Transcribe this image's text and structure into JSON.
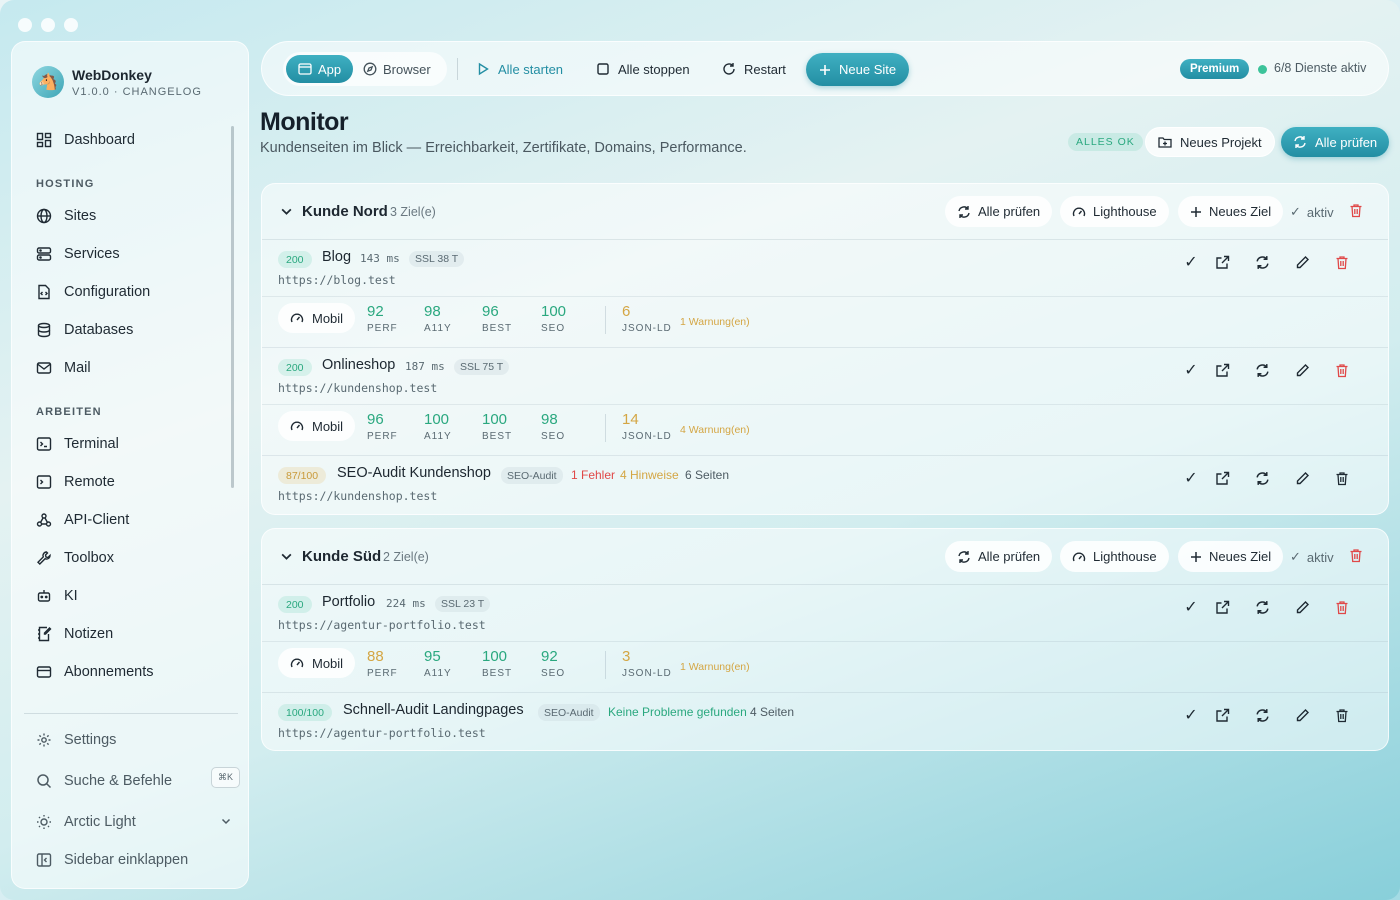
{
  "brand": {
    "name": "WebDonkey",
    "version": "V1.0.0 · CHANGELOG"
  },
  "sidebar": {
    "dashboard": "Dashboard",
    "hosting_label": "HOSTING",
    "hosting": [
      "Sites",
      "Services",
      "Configuration",
      "Databases",
      "Mail"
    ],
    "arbeiten_label": "ARBEITEN",
    "arbeiten": [
      "Terminal",
      "Remote",
      "API-Client",
      "Toolbox",
      "KI",
      "Notizen",
      "Abonnements"
    ],
    "settings": "Settings",
    "search": "Suche & Befehle",
    "search_shortcut": "⌘K",
    "theme": "Arctic Light",
    "collapse": "Sidebar einklappen"
  },
  "topbar": {
    "app": "App",
    "browser": "Browser",
    "start_all": "Alle starten",
    "stop_all": "Alle stoppen",
    "restart": "Restart",
    "new_site": "Neue Site",
    "premium": "Premium",
    "status": "6/8 Dienste aktiv"
  },
  "header": {
    "title": "Monitor",
    "subtitle": "Kundenseiten im Blick — Erreichbarkeit, Zertifikate, Domains, Performance.",
    "ok_badge": "ALLES OK",
    "new_project": "Neues Projekt",
    "check_all": "Alle prüfen"
  },
  "group_buttons": {
    "check_all": "Alle prüfen",
    "lighthouse": "Lighthouse",
    "new_target": "Neues Ziel",
    "active": "aktiv"
  },
  "groups": [
    {
      "name": "Kunde Nord",
      "count": "3 Ziel(e)",
      "rows": [
        {
          "code": "200",
          "name": "Blog",
          "ms": "143 ms",
          "ssl": "SSL 38 T",
          "url": "https://blog.test",
          "device": "Mobil",
          "scores": [
            {
              "v": "92",
              "l": "PERF"
            },
            {
              "v": "98",
              "l": "A11Y"
            },
            {
              "v": "96",
              "l": "BEST"
            },
            {
              "v": "100",
              "l": "SEO"
            }
          ],
          "jsonld": {
            "v": "6",
            "l": "JSON-LD"
          },
          "warnings": "1 Warnung(en)"
        },
        {
          "code": "200",
          "name": "Onlineshop",
          "ms": "187 ms",
          "ssl": "SSL 75 T",
          "url": "https://kundenshop.test",
          "device": "Mobil",
          "scores": [
            {
              "v": "96",
              "l": "PERF"
            },
            {
              "v": "100",
              "l": "A11Y"
            },
            {
              "v": "100",
              "l": "BEST"
            },
            {
              "v": "98",
              "l": "SEO"
            }
          ],
          "jsonld": {
            "v": "14",
            "l": "JSON-LD"
          },
          "warnings": "4 Warnung(en)"
        },
        {
          "code": "87/100",
          "name": "SEO-Audit Kundenshop",
          "tag": "SEO-Audit",
          "errors": "1 Fehler",
          "hints": "4 Hinweise",
          "pages": "6 Seiten",
          "url": "https://kundenshop.test"
        }
      ]
    },
    {
      "name": "Kunde Süd",
      "count": "2 Ziel(e)",
      "rows": [
        {
          "code": "200",
          "name": "Portfolio",
          "ms": "224 ms",
          "ssl": "SSL 23 T",
          "url": "https://agentur-portfolio.test",
          "device": "Mobil",
          "scores": [
            {
              "v": "88",
              "l": "PERF"
            },
            {
              "v": "95",
              "l": "A11Y"
            },
            {
              "v": "100",
              "l": "BEST"
            },
            {
              "v": "92",
              "l": "SEO"
            }
          ],
          "jsonld": {
            "v": "3",
            "l": "JSON-LD"
          },
          "warnings": "1 Warnung(en)"
        },
        {
          "code": "100/100",
          "name": "Schnell-Audit Landingpages",
          "tag": "SEO-Audit",
          "ok": "Keine Probleme gefunden",
          "pages": "4 Seiten",
          "url": "https://agentur-portfolio.test"
        }
      ]
    }
  ],
  "colors": {
    "accent": "#238ea3",
    "ok": "#2aa87f",
    "warn": "#d4a644",
    "error": "#e04848"
  }
}
